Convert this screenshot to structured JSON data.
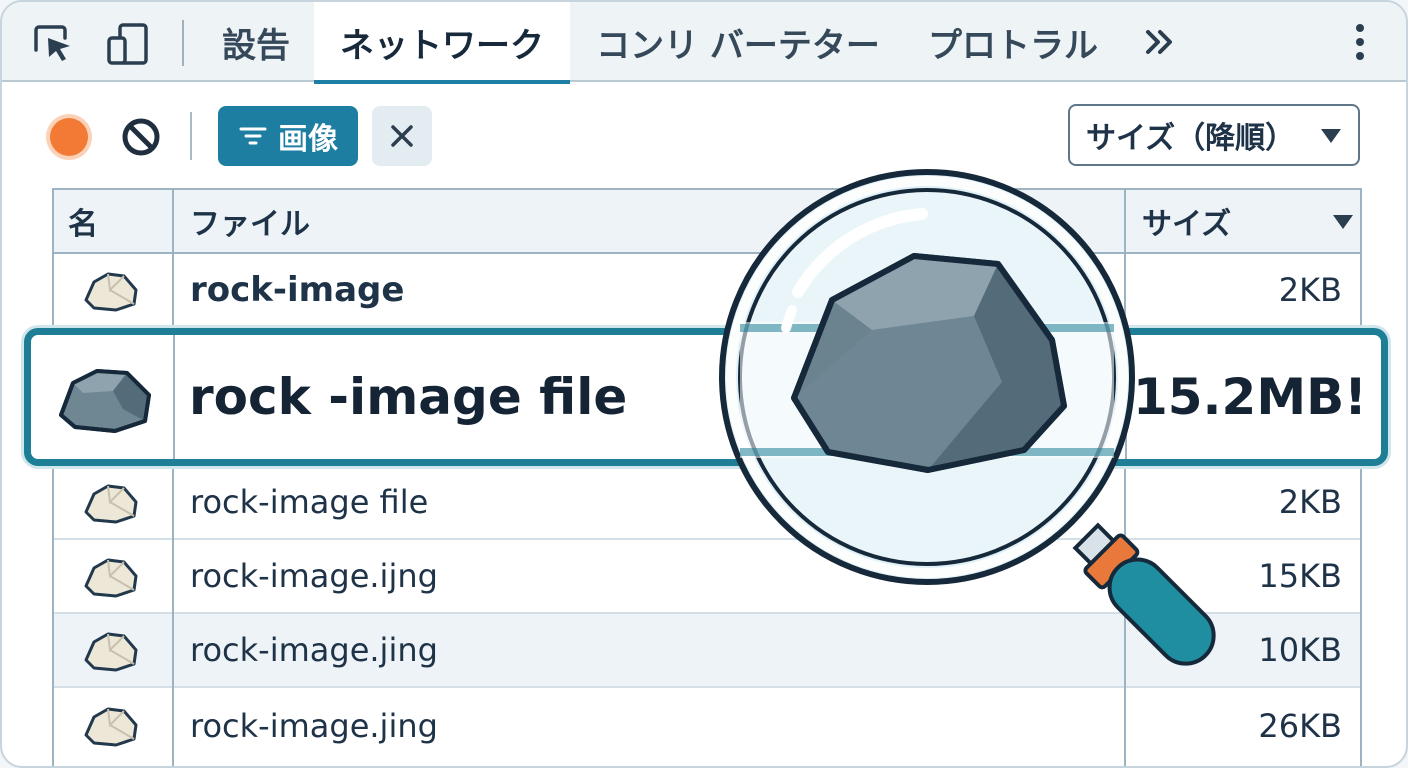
{
  "tabs": [
    {
      "label": "設告",
      "active": false
    },
    {
      "label": "ネットワーク",
      "active": true
    },
    {
      "label": "コンリ バーテター",
      "active": false
    },
    {
      "label": "プロトラル",
      "active": false
    }
  ],
  "toolbar": {
    "filter_label": "画像",
    "sort_label": "サイズ（降順）"
  },
  "table": {
    "headers": {
      "name": "名",
      "file": "ファイル",
      "size": "サイズ"
    },
    "rows": [
      {
        "file": "rock-image",
        "size": "2KB"
      },
      {
        "file": "rock -image file",
        "size": "15.2MB!"
      },
      {
        "file": "rock-image file",
        "size": "2KB"
      },
      {
        "file": "rock-image.ijng",
        "size": "15KB"
      },
      {
        "file": "rock-image.jing",
        "size": "10KB"
      },
      {
        "file": "rock-image.jing",
        "size": "26KB"
      }
    ]
  },
  "icons": {
    "inspect": "cursor-select-icon",
    "device": "device-toggle-icon",
    "more_tabs": "chevron-double-right-icon",
    "menu": "kebab-menu-icon",
    "record": "record-dot-icon",
    "clear": "block-icon",
    "filter": "filter-lines-icon",
    "magnifier": "magnifying-glass-icon"
  },
  "colors": {
    "accent": "#1e7ea2",
    "highlight_border": "#1d7e95",
    "record": "#f27a35",
    "magnifier_handle": "#1e8ea0",
    "magnifier_handle_cap": "#e8793a"
  }
}
